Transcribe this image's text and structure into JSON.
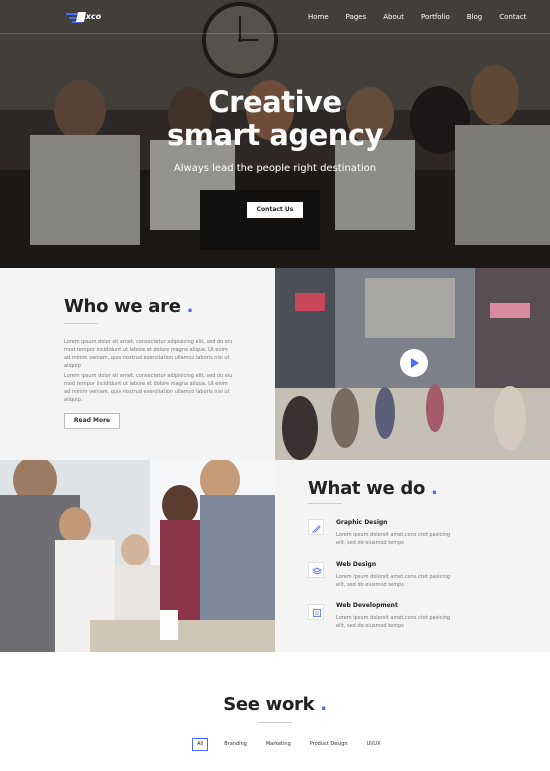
{
  "nav": {
    "logo_text": "ixco",
    "items": [
      "Home",
      "Pages",
      "About",
      "Portfolio",
      "Blog",
      "Contact"
    ]
  },
  "hero": {
    "title_line1": "Creative",
    "title_line2": "smart agency",
    "subtitle": "Always lead the people right destination",
    "cta_label": "Contact Us"
  },
  "who": {
    "heading": "Who we are",
    "para1": "Lorem ipsum dolor sit amet, consectetur adipisicing elit, sed do eiu mod tempor incididunt ut labore et dolore magna aliqua. Ut enim ad minim veniam, quis nostrud exercitation ullamco laboris nisi ut aliquip",
    "para2": "Lorem ipsum dolor sit amet, consectetur adipisicing elit, sed do eiu mod tempor incididunt ut labore et dolore magna aliqua. Ut enim ad minim veniam, quis nostrud exercitation ullamco laboris nisi ut aliquip.",
    "button_label": "Read More"
  },
  "what": {
    "heading": "What we do",
    "services": [
      {
        "title": "Graphic Design",
        "desc": "Lorem ipsum dolorsit amet,cons ctet pasicing elit, sed do eiusmod temps"
      },
      {
        "title": "Web Design",
        "desc": "Lorem ipsum dolorsit amet,cons ctet pasicing elit, sed do eiusmod temps"
      },
      {
        "title": "Web Development",
        "desc": "Lorem ipsum dolorsit amet,cons ctet pasicing elit, sed do eiusmod temps"
      }
    ]
  },
  "work": {
    "heading": "See work",
    "filters": [
      "All",
      "Branding",
      "Marketing",
      "Product Design",
      "UI/UX"
    ]
  },
  "colors": {
    "accent": "#4a6cf7",
    "section_bg": "#f4f4f4"
  }
}
